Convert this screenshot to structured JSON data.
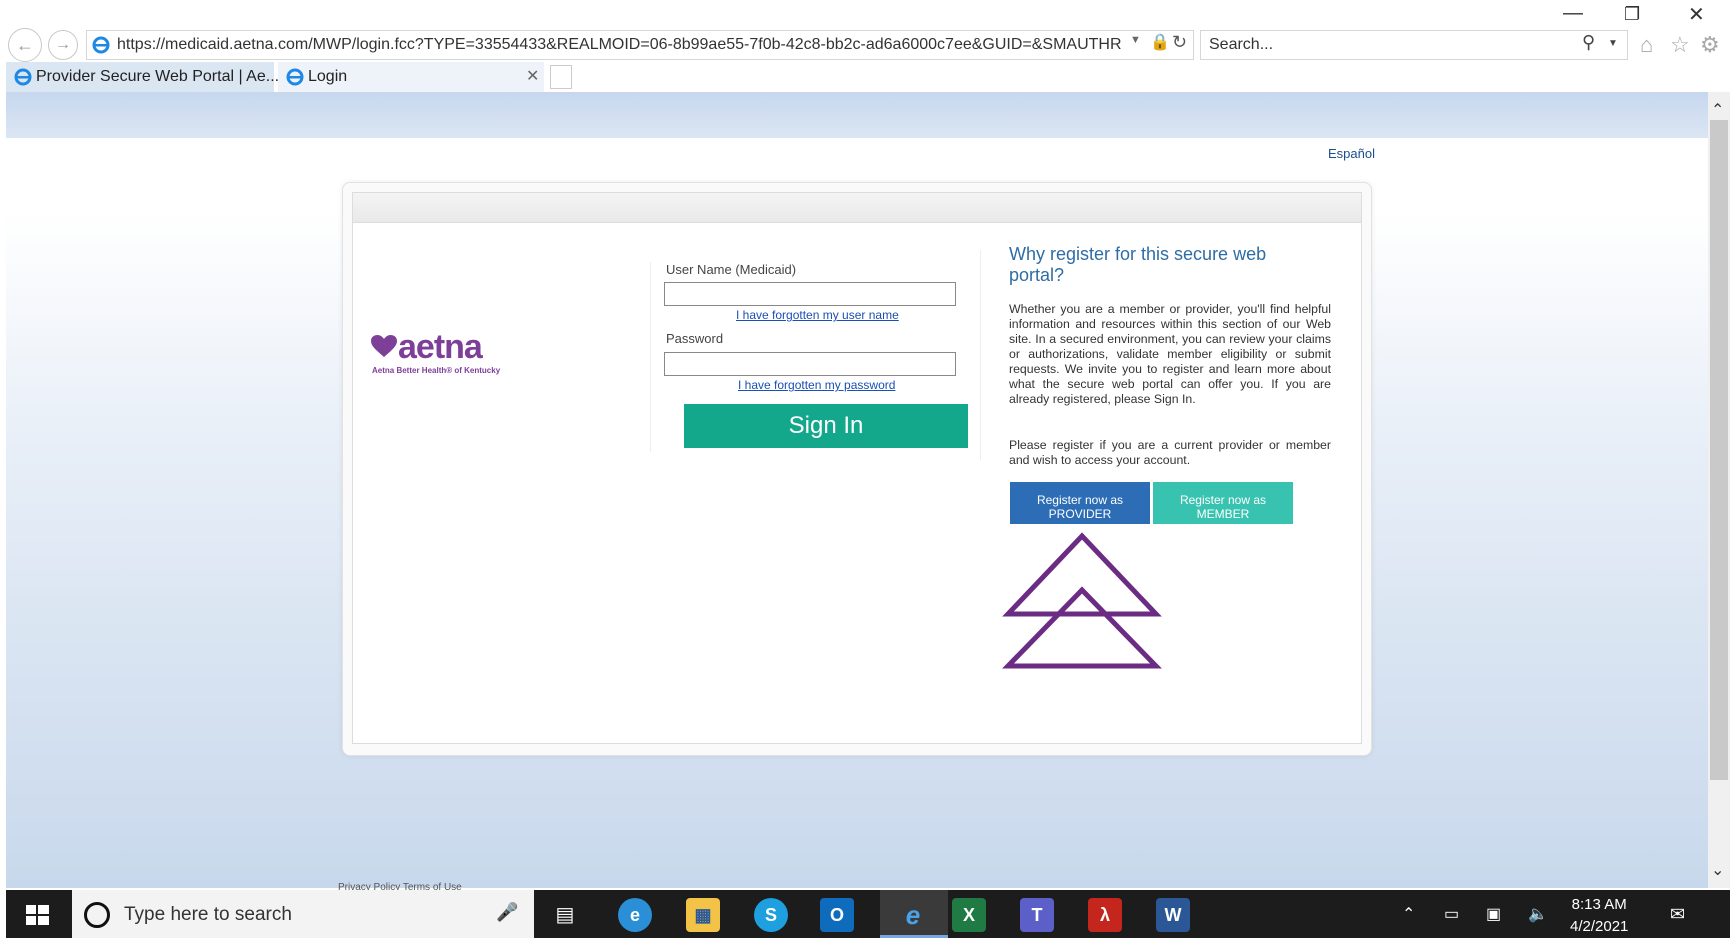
{
  "browser": {
    "url": "https://medicaid.aetna.com/MWP/login.fcc?TYPE=33554433&REALMOID=06-8b99ae55-7f0b-42c8-bb2c-ad6a6000c7ee&GUID=&SMAUTHR",
    "search_placeholder": "Search...",
    "tabs": [
      {
        "label": "Provider Secure Web Portal | Ae..."
      },
      {
        "label": "Login"
      }
    ]
  },
  "page": {
    "language_link": "Español",
    "brand": {
      "name": "aetna",
      "tagline": "Aetna Better Health® of Kentucky"
    },
    "form": {
      "username_label": "User Name (Medicaid)",
      "username_value": "",
      "forgot_username": "I have forgotten my user name",
      "password_label": "Password",
      "password_value": "",
      "forgot_password": "I have forgotten my password",
      "signin_label": "Sign In"
    },
    "info": {
      "title": "Why register for this secure web portal?",
      "paragraph1": "Whether you are a member or provider, you'll find helpful information and resources within this section of our Web site. In a secured environment, you can review your claims or authorizations, validate member eligibility or submit requests. We invite you to register and learn more about what the secure web portal can offer you. If you are already registered, please Sign In.",
      "paragraph2": "Please register if you are a current provider or member and wish to access your account.",
      "register_provider": "Register now as PROVIDER",
      "register_member": "Register now as MEMBER"
    },
    "footer": "Privacy Policy  Terms of Use"
  },
  "taskbar": {
    "search_placeholder": "Type here to search",
    "time": "8:13 AM",
    "date": "4/2/2021"
  },
  "colors": {
    "brand_purple": "#7d3f98",
    "signin_green": "#13a88c",
    "provider_blue": "#2d6db5",
    "member_teal": "#38c3b0"
  }
}
